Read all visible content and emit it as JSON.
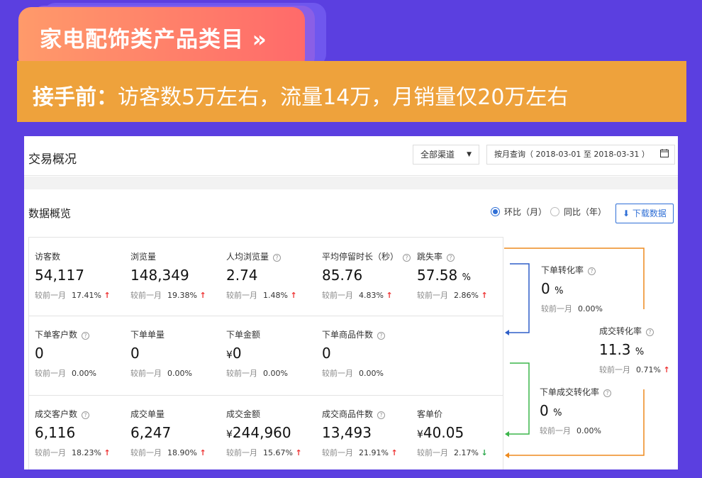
{
  "header": {
    "title": "家电配饰类产品类目 »",
    "band_bold": "接手前：",
    "band_text": "访客数5万左右，流量14万，月销量仅20万左右"
  },
  "panel": {
    "title": "交易概况",
    "channel_select": "全部渠道",
    "date_range": "按月查询（ 2018-03-01 至 2018-03-31 ）",
    "section_title": "数据概览",
    "radio_mom": "环比（月）",
    "radio_yoy": "同比（年）",
    "download": "下载数据"
  },
  "compare_label": "较前一月",
  "metrics": [
    {
      "label": "访客数",
      "value": "54,117",
      "change": "17.41%",
      "trend": "up"
    },
    {
      "label": "浏览量",
      "value": "148,349",
      "change": "19.38%",
      "trend": "up"
    },
    {
      "label": "人均浏览量",
      "value": "2.74",
      "change": "1.48%",
      "trend": "up"
    },
    {
      "label": "平均停留时长（秒）",
      "value": "85.76",
      "change": "4.83%",
      "trend": "up"
    },
    {
      "label": "跳失率",
      "value": "57.58",
      "unit": "%",
      "change": "2.86%",
      "trend": "up"
    },
    {
      "label": "下单客户数",
      "value": "0",
      "change": "0.00%"
    },
    {
      "label": "下单单量",
      "value": "0",
      "change": "0.00%"
    },
    {
      "label": "下单金额",
      "currency": "¥",
      "value": "0",
      "change": "0.00%"
    },
    {
      "label": "下单商品件数",
      "value": "0",
      "change": "0.00%"
    },
    {
      "label": "成交客户数",
      "value": "6,116",
      "change": "18.23%",
      "trend": "up"
    },
    {
      "label": "成交单量",
      "value": "6,247",
      "change": "18.90%",
      "trend": "up"
    },
    {
      "label": "成交金额",
      "currency": "¥",
      "value": "244,960",
      "change": "15.67%",
      "trend": "up"
    },
    {
      "label": "成交商品件数",
      "value": "13,493",
      "change": "21.91%",
      "trend": "up"
    },
    {
      "label": "客单价",
      "currency": "¥",
      "value": "40.05",
      "change": "2.17%",
      "trend": "down"
    }
  ],
  "conversions": [
    {
      "label": "下单转化率",
      "value": "0",
      "unit": "%",
      "change": "0.00%"
    },
    {
      "label": "成交转化率",
      "value": "11.3",
      "unit": "%",
      "change": "0.71%",
      "trend": "up"
    },
    {
      "label": "下单成交转化率",
      "value": "0",
      "unit": "%",
      "change": "0.00%"
    }
  ],
  "colors": {
    "background": "#5b3fe0",
    "title_tab": "#ff7a6a",
    "band": "#eea23c",
    "accent_blue": "#2f6fd6",
    "flow_blue": "#2f5fc8",
    "flow_green": "#3bb54a",
    "flow_orange": "#ee8a1e",
    "up": "#e33333",
    "down": "#2aa84a"
  }
}
